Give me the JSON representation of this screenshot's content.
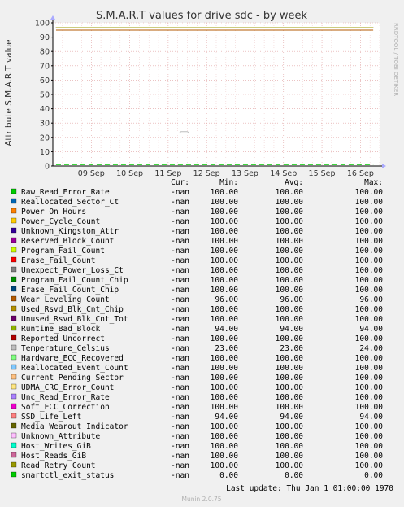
{
  "chart_data": {
    "type": "line",
    "title": "S.M.A.R.T values for drive sdc - by week",
    "ylabel": "Attribute S.M.A.R.T value",
    "watermark": "RRDTOOL / TOBI OETIKER",
    "footer": "Munin 2.0.75",
    "ylim": [
      0,
      100
    ],
    "yticks": [
      0,
      10,
      20,
      30,
      40,
      50,
      60,
      70,
      80,
      90,
      100
    ],
    "x_range": [
      "2020-09-08T00:00",
      "2020-09-16T12:00"
    ],
    "xticks": [
      "09 Sep",
      "10 Sep",
      "11 Sep",
      "12 Sep",
      "13 Sep",
      "14 Sep",
      "15 Sep",
      "16 Sep"
    ],
    "grid": true,
    "legend_headers": [
      "Cur:",
      "Min:",
      "Avg:",
      "Max:"
    ],
    "last_update": "Last update: Thu Jan  1 01:00:00 1970",
    "series": [
      {
        "name": "Raw_Read_Error_Rate",
        "color": "#00cc00",
        "cur": "-nan",
        "min": "100.00",
        "avg": "100.00",
        "max": "100.00",
        "value": 100
      },
      {
        "name": "Reallocated_Sector_Ct",
        "color": "#0066b3",
        "cur": "-nan",
        "min": "100.00",
        "avg": "100.00",
        "max": "100.00",
        "value": 100
      },
      {
        "name": "Power_On_Hours",
        "color": "#ff8000",
        "cur": "-nan",
        "min": "100.00",
        "avg": "100.00",
        "max": "100.00",
        "value": 100
      },
      {
        "name": "Power_Cycle_Count",
        "color": "#ffcc00",
        "cur": "-nan",
        "min": "100.00",
        "avg": "100.00",
        "max": "100.00",
        "value": 100
      },
      {
        "name": "Unknown_Kingston_Attr",
        "color": "#330099",
        "cur": "-nan",
        "min": "100.00",
        "avg": "100.00",
        "max": "100.00",
        "value": 100
      },
      {
        "name": "Reserved_Block_Count",
        "color": "#990099",
        "cur": "-nan",
        "min": "100.00",
        "avg": "100.00",
        "max": "100.00",
        "value": 100
      },
      {
        "name": "Program_Fail_Count",
        "color": "#ccff00",
        "cur": "-nan",
        "min": "100.00",
        "avg": "100.00",
        "max": "100.00",
        "value": 100
      },
      {
        "name": "Erase_Fail_Count",
        "color": "#ff0000",
        "cur": "-nan",
        "min": "100.00",
        "avg": "100.00",
        "max": "100.00",
        "value": 100
      },
      {
        "name": "Unexpect_Power_Loss_Ct",
        "color": "#808080",
        "cur": "-nan",
        "min": "100.00",
        "avg": "100.00",
        "max": "100.00",
        "value": 100
      },
      {
        "name": "Program_Fail_Count_Chip",
        "color": "#008f00",
        "cur": "-nan",
        "min": "100.00",
        "avg": "100.00",
        "max": "100.00",
        "value": 100
      },
      {
        "name": "Erase_Fail_Count_Chip",
        "color": "#00487d",
        "cur": "-nan",
        "min": "100.00",
        "avg": "100.00",
        "max": "100.00",
        "value": 100
      },
      {
        "name": "Wear_Leveling_Count",
        "color": "#b35a00",
        "cur": "-nan",
        "min": "96.00",
        "avg": "96.00",
        "max": "96.00",
        "value": 96
      },
      {
        "name": "Used_Rsvd_Blk_Cnt_Chip",
        "color": "#b38f00",
        "cur": "-nan",
        "min": "100.00",
        "avg": "100.00",
        "max": "100.00",
        "value": 100
      },
      {
        "name": "Unused_Rsvd_Blk_Cnt_Tot",
        "color": "#6b006b",
        "cur": "-nan",
        "min": "100.00",
        "avg": "100.00",
        "max": "100.00",
        "value": 100
      },
      {
        "name": "Runtime_Bad_Block",
        "color": "#8fb300",
        "cur": "-nan",
        "min": "94.00",
        "avg": "94.00",
        "max": "94.00",
        "value": 94
      },
      {
        "name": "Reported_Uncorrect",
        "color": "#b30000",
        "cur": "-nan",
        "min": "100.00",
        "avg": "100.00",
        "max": "100.00",
        "value": 100
      },
      {
        "name": "Temperature_Celsius",
        "color": "#bebebe",
        "cur": "-nan",
        "min": "23.00",
        "avg": "23.00",
        "max": "24.00",
        "value": 23
      },
      {
        "name": "Hardware_ECC_Recovered",
        "color": "#80ff80",
        "cur": "-nan",
        "min": "100.00",
        "avg": "100.00",
        "max": "100.00",
        "value": 100
      },
      {
        "name": "Reallocated_Event_Count",
        "color": "#80c9ff",
        "cur": "-nan",
        "min": "100.00",
        "avg": "100.00",
        "max": "100.00",
        "value": 100
      },
      {
        "name": "Current_Pending_Sector",
        "color": "#ffc080",
        "cur": "-nan",
        "min": "100.00",
        "avg": "100.00",
        "max": "100.00",
        "value": 100
      },
      {
        "name": "UDMA_CRC_Error_Count",
        "color": "#ffe680",
        "cur": "-nan",
        "min": "100.00",
        "avg": "100.00",
        "max": "100.00",
        "value": 100
      },
      {
        "name": "Unc_Read_Error_Rate",
        "color": "#aa80ff",
        "cur": "-nan",
        "min": "100.00",
        "avg": "100.00",
        "max": "100.00",
        "value": 100
      },
      {
        "name": "Soft_ECC_Correction",
        "color": "#ee00cc",
        "cur": "-nan",
        "min": "100.00",
        "avg": "100.00",
        "max": "100.00",
        "value": 100
      },
      {
        "name": "SSD_Life_Left",
        "color": "#ff8080",
        "cur": "-nan",
        "min": "94.00",
        "avg": "94.00",
        "max": "94.00",
        "value": 94
      },
      {
        "name": "Media_Wearout_Indicator",
        "color": "#666600",
        "cur": "-nan",
        "min": "100.00",
        "avg": "100.00",
        "max": "100.00",
        "value": 100
      },
      {
        "name": "Unknown_Attribute",
        "color": "#ffbfff",
        "cur": "-nan",
        "min": "100.00",
        "avg": "100.00",
        "max": "100.00",
        "value": 100
      },
      {
        "name": "Host_Writes_GiB",
        "color": "#00ffcc",
        "cur": "-nan",
        "min": "100.00",
        "avg": "100.00",
        "max": "100.00",
        "value": 100
      },
      {
        "name": "Host_Reads_GiB",
        "color": "#cc6699",
        "cur": "-nan",
        "min": "100.00",
        "avg": "100.00",
        "max": "100.00",
        "value": 100
      },
      {
        "name": "Read_Retry_Count",
        "color": "#999900",
        "cur": "-nan",
        "min": "100.00",
        "avg": "100.00",
        "max": "100.00",
        "value": 100
      },
      {
        "name": "smartctl_exit_status",
        "color": "#00cc00",
        "cur": "-nan",
        "min": "0.00",
        "avg": "0.00",
        "max": "0.00",
        "value": 0
      }
    ]
  }
}
